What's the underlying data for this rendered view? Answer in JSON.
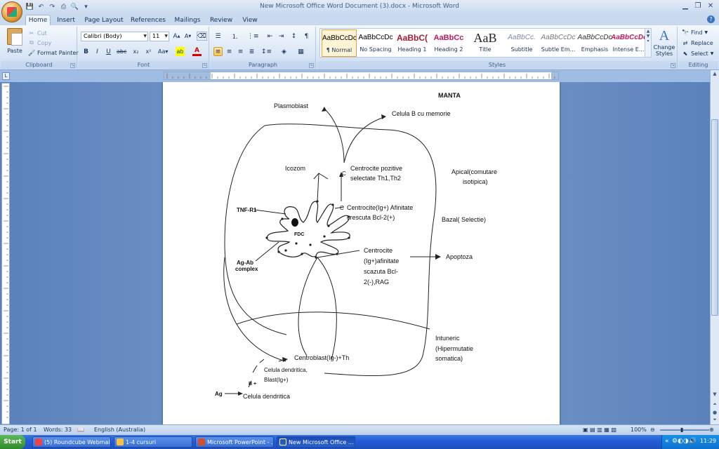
{
  "window": {
    "title": "New Microsoft Office Word Document (3).docx - Microsoft Word"
  },
  "tabs": [
    "Home",
    "Insert",
    "Page Layout",
    "References",
    "Mailings",
    "Review",
    "View"
  ],
  "ribbon": {
    "clipboard": {
      "paste": "Paste",
      "cut": "Cut",
      "copy": "Copy",
      "format_painter": "Format Painter",
      "label": "Clipboard"
    },
    "font": {
      "name": "Calibri (Body)",
      "size": "11",
      "label": "Font"
    },
    "paragraph": {
      "label": "Paragraph"
    },
    "styles": {
      "label": "Styles",
      "items": [
        {
          "sample": "AaBbCcDc",
          "name": "¶ Normal",
          "color": "#000000"
        },
        {
          "sample": "AaBbCcDc",
          "name": "No Spacing",
          "color": "#000000"
        },
        {
          "sample": "AaBbC(",
          "name": "Heading 1",
          "color": "#a51c30"
        },
        {
          "sample": "AaBbCc",
          "name": "Heading 2",
          "color": "#c2185b"
        },
        {
          "sample": "AaB",
          "name": "Title",
          "color": "#222222"
        },
        {
          "sample": "AaBbCc.",
          "name": "Subtitle",
          "color": "#7a8bb0"
        },
        {
          "sample": "AaBbCcDc",
          "name": "Subtle Em...",
          "color": "#7a7a7a"
        },
        {
          "sample": "AaBbCcDc",
          "name": "Emphasis",
          "color": "#333333"
        },
        {
          "sample": "AaBbCcDc",
          "name": "Intense E...",
          "color": "#c2185b"
        }
      ],
      "change_styles": "Change Styles"
    },
    "editing": {
      "find": "Find",
      "replace": "Replace",
      "select": "Select",
      "label": "Editing"
    }
  },
  "figure": {
    "manta": "MANTA",
    "plasmoblast": "Plasmoblast",
    "celula_b_memorie": "Celula B cu memorie",
    "icozom": "Icozom",
    "centrocite_poz_1": "Centrocite pozitive",
    "centrocite_poz_2": "selectate Th1,Th2",
    "c_top": "C",
    "c_mid": "C",
    "apical_1": "Apical(comutare",
    "apical_2": "isotipica)",
    "tnf": "TNF-R1",
    "centrocite_ig_1": "Centrocite(Ig+) Afinitate",
    "centrocite_ig_2": "crescuta Bcl-2(+)",
    "bazal": "Bazal( Selectie)",
    "fdc": "FDC",
    "agab_1": "Ag-Ab",
    "agab_2": "complex",
    "centrocite_neg_1": "Centrocite",
    "centrocite_neg_2": "(Ig+)afinitate",
    "centrocite_neg_3": "scazuta Bcl-",
    "centrocite_neg_4": "2(-),RAG",
    "apoptoza": "Apoptoza",
    "intuneric_1": "Intuneric",
    "intuneric_2": "(Hipermutatie",
    "intuneric_3": "somatica)",
    "centroblast": "Centroblast(Ig-)+Th",
    "celula_dendritica_blast_1": "Celula dendritica,",
    "celula_dendritica_blast_2": "Blast(Ig+)",
    "b_plus": "B +",
    "ag": "Ag",
    "celula_dendritica": "Celula dendritica"
  },
  "status": {
    "page": "Page: 1 of 1",
    "words": "Words: 33",
    "language": "English (Australia)",
    "zoom": "100%"
  },
  "taskbar": {
    "start": "Start",
    "items": [
      "(5) Roundcube Webmail...",
      "1-4 cursuri",
      "Microsoft PowerPoint - ...",
      "New Microsoft Office ..."
    ],
    "clock": "11:29"
  }
}
